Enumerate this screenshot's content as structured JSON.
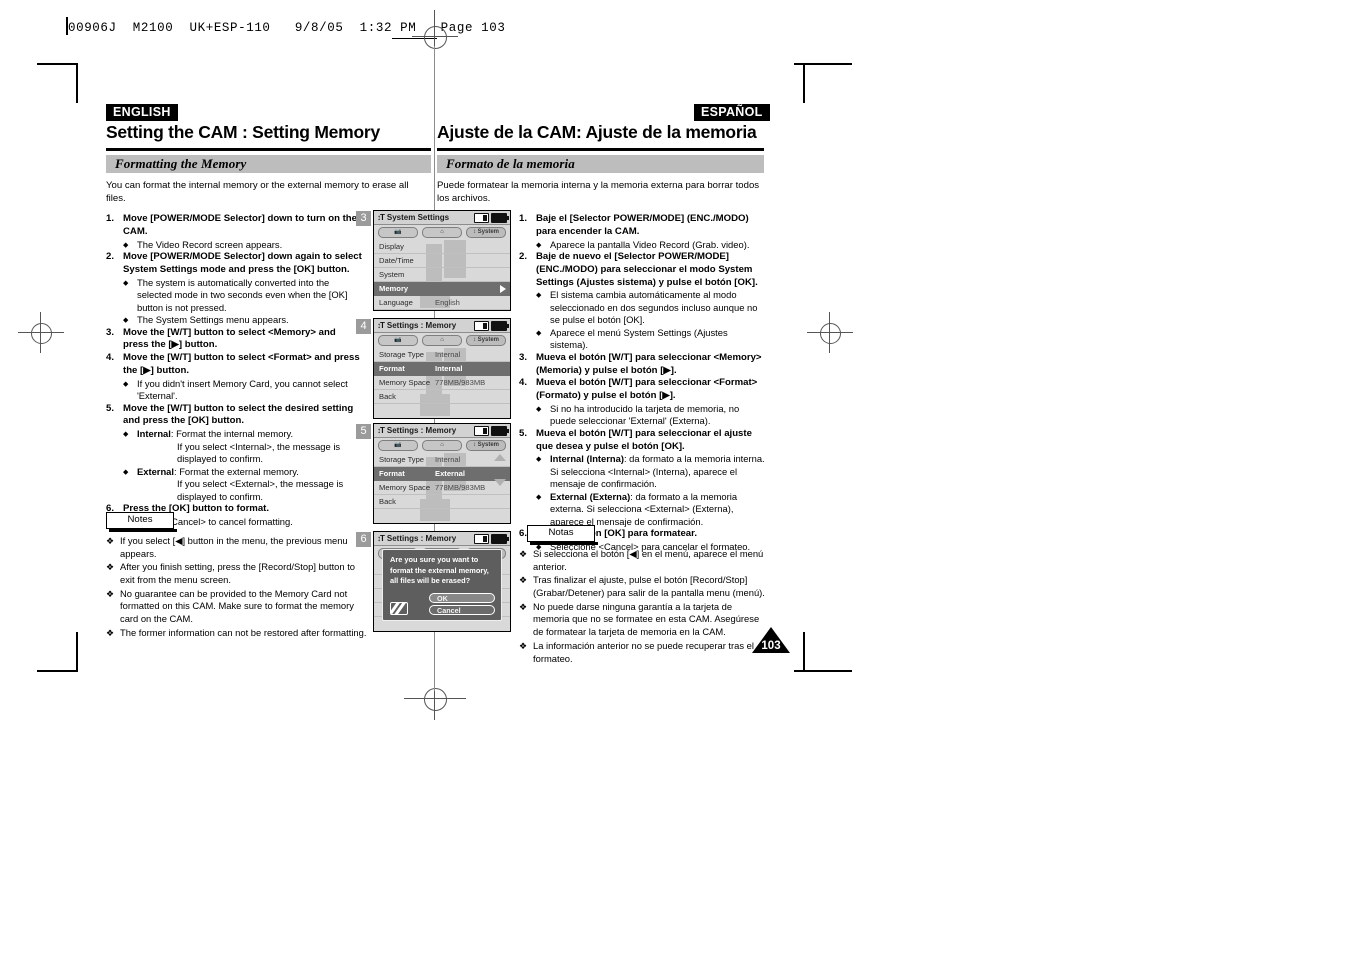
{
  "slug": {
    "text": "00906J  M2100  UK+ESP-110   9/8/05  1:32 PM   Page 103"
  },
  "english": {
    "lang_badge": "ENGLISH",
    "title": "Setting the CAM : Setting Memory",
    "section": "Formatting the Memory",
    "intro": "You can format the internal memory or the external memory to erase all files.",
    "steps": [
      {
        "num": "1.",
        "text": "Move [POWER/MODE Selector] down to turn on the CAM.",
        "subs": [
          {
            "bullet": "◆",
            "text": "The Video Record screen appears."
          }
        ]
      },
      {
        "num": "2.",
        "text": "Move [POWER/MODE Selector] down again to select System Settings mode and press the [OK] button.",
        "subs": [
          {
            "bullet": "◆",
            "text": "The system is automatically converted into the selected mode in two seconds even when the [OK] button is not pressed."
          },
          {
            "bullet": "◆",
            "text": "The System Settings menu appears."
          }
        ]
      },
      {
        "num": "3.",
        "text": "Move the [W/T] button to select <Memory> and press the [▶] button.",
        "subs": []
      },
      {
        "num": "4.",
        "text": "Move the [W/T] button to select <Format> and press the [▶] button.",
        "subs": [
          {
            "bullet": "◆",
            "text": "If you didn't insert Memory Card, you cannot select 'External'."
          }
        ]
      },
      {
        "num": "5.",
        "text": "Move the [W/T] button to select the desired setting and press the [OK] button.",
        "subs": [
          {
            "bullet": "◆",
            "label": "Internal",
            "text": ": Format the internal memory.",
            "indent": "If you select  <Internal>, the message is displayed to confirm."
          },
          {
            "bullet": "◆",
            "label": "External",
            "text": ": Format the external memory.",
            "indent": "If you select <External>, the message is displayed to confirm."
          }
        ]
      },
      {
        "num": "6.",
        "text": "Press the [OK] button to format.",
        "subs": [
          {
            "bullet": "◆",
            "text": "Select <Cancel> to cancel formatting."
          }
        ]
      }
    ],
    "notes_label": "Notes",
    "notes": [
      "If you select [◀] button in the menu, the previous menu appears.",
      "After you finish setting, press the [Record/Stop] button to exit from the menu screen.",
      "No guarantee can be provided to the Memory Card not formatted on this CAM. Make sure to format the memory card on the CAM.",
      "The former information can not be restored after formatting."
    ]
  },
  "spanish": {
    "lang_badge": "ESPAÑOL",
    "title": "Ajuste de la CAM: Ajuste de la memoria",
    "section": "Formato de la memoria",
    "intro": "Puede formatear la memoria interna y la memoria externa para borrar todos los archivos.",
    "steps": [
      {
        "num": "1.",
        "text": "Baje el [Selector POWER/MODE] (ENC./MODO) para encender la CAM.",
        "subs": [
          {
            "bullet": "◆",
            "text": "Aparece la pantalla Video Record (Grab. video)."
          }
        ]
      },
      {
        "num": "2.",
        "text": "Baje de nuevo el [Selector POWER/MODE] (ENC./MODO) para seleccionar el modo System Settings (Ajustes sistema) y pulse el botón [OK].",
        "subs": [
          {
            "bullet": "◆",
            "text": "El sistema cambia automáticamente al modo seleccionado en dos segundos incluso aunque no se pulse el botón [OK]."
          },
          {
            "bullet": "◆",
            "text": "Aparece el menú System Settings (Ajustes sistema)."
          }
        ]
      },
      {
        "num": "3.",
        "text": "Mueva el botón [W/T] para seleccionar <Memory> (Memoria) y pulse el botón [▶].",
        "subs": []
      },
      {
        "num": "4.",
        "text": "Mueva el botón [W/T] para seleccionar <Format> (Formato) y pulse el botón [▶].",
        "subs": [
          {
            "bullet": "◆",
            "text": "Si no ha introducido la tarjeta de memoria, no puede seleccionar 'External' (Externa)."
          }
        ]
      },
      {
        "num": "5.",
        "text": "Mueva el botón [W/T] para seleccionar el ajuste que desea y pulse el botón [OK].",
        "subs": [
          {
            "bullet": "◆",
            "label": "Internal (Interna)",
            "text": ": da formato a la memoria interna. Si selecciona <Internal> (Interna), aparece el mensaje de confirmación."
          },
          {
            "bullet": "◆",
            "label": "External (Externa)",
            "text": ": da formato a la memoria externa. Si selecciona <External> (Externa), aparece el mensaje de confirmación."
          }
        ]
      },
      {
        "num": "6.",
        "text": "Pulse el botón [OK] para formatear.",
        "subs": [
          {
            "bullet": "◆",
            "text": "Seleccione <Cancel> para cancelar el formateo."
          }
        ]
      }
    ],
    "notes_label": "Notas",
    "notes": [
      "Si selecciona el botón [◀] en el menú, aparece el menú anterior.",
      "Tras finalizar el ajuste, pulse el botón [Record/Stop] (Grabar/Detener) para salir de la pantalla menu (menú).",
      "No puede darse ninguna garantía a la tarjeta de memoria que no se formatee en esta CAM. Asegúrese de formatear la tarjeta de memoria en la CAM.",
      "La información anterior no se puede recuperar tras el formateo."
    ]
  },
  "chips": [
    "3",
    "4",
    "5",
    "6"
  ],
  "lcds": [
    {
      "title": "System Settings",
      "tabs": [
        "record-tab",
        "play-tab",
        "System"
      ],
      "active_tab": 2,
      "rows": [
        {
          "label": "Display",
          "value": "",
          "selected": false
        },
        {
          "label": "Date/Time",
          "value": "",
          "selected": false
        },
        {
          "label": "System",
          "value": "",
          "selected": false
        },
        {
          "label": "Memory",
          "value": "",
          "selected": true,
          "caret": true
        },
        {
          "label": "Language",
          "value": "English",
          "selected": false
        }
      ]
    },
    {
      "title": "Settings : Memory",
      "tabs": [
        "record-tab",
        "play-tab",
        "System"
      ],
      "active_tab": 2,
      "rows": [
        {
          "label": "Storage Type",
          "value": "Internal",
          "selected": false
        },
        {
          "label": "Format",
          "value": "Internal",
          "selected": true
        },
        {
          "label": "Memory Space",
          "value": "778MB/983MB",
          "selected": false
        },
        {
          "label": "Back",
          "value": "",
          "selected": false
        }
      ]
    },
    {
      "title": "Settings : Memory",
      "tabs": [
        "record-tab",
        "play-tab",
        "System"
      ],
      "active_tab": 2,
      "rows": [
        {
          "label": "Storage Type",
          "value": "Internal",
          "selected": false
        },
        {
          "label": "Format",
          "value": "External",
          "selected": true
        },
        {
          "label": "Memory Space",
          "value": "778MB/983MB",
          "selected": false
        },
        {
          "label": "Back",
          "value": "",
          "selected": false
        }
      ]
    },
    {
      "title": "Settings : Memory",
      "tabs": [
        "record-tab",
        "play-tab",
        "System"
      ],
      "active_tab": 2,
      "dialog": {
        "message": "Are you sure you want to format the external memory, all files will be erased?",
        "ok": "OK",
        "cancel": "Cancel"
      }
    }
  ],
  "page_number": "103"
}
